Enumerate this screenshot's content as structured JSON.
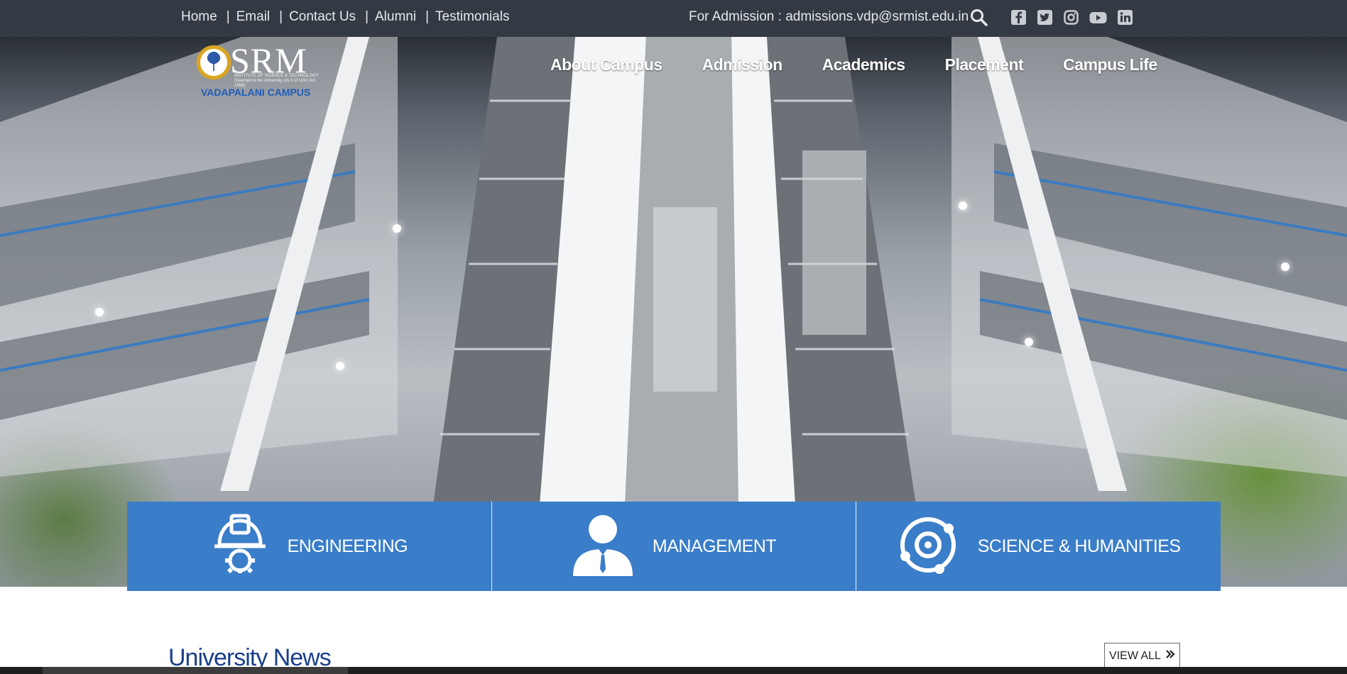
{
  "topbar": {
    "links": [
      "Home",
      "Email",
      "Contact Us",
      "Alumni",
      "Testimonials"
    ],
    "separator": "|",
    "admission_text": "For Admission : admissions.vdp@srmist.edu.in",
    "icons": [
      "search-icon",
      "facebook-icon",
      "twitter-icon",
      "instagram-icon",
      "youtube-icon",
      "linkedin-icon"
    ]
  },
  "logo": {
    "name": "SRM",
    "subtitle": "INSTITUTE OF SCIENCE & TECHNOLOGY (Deemed to be University u/s 3 of UGC Act, 1956)",
    "campus": "VADAPALANI CAMPUS"
  },
  "nav": {
    "items": [
      "About Campus",
      "Admission",
      "Academics",
      "Placement",
      "Campus Life"
    ]
  },
  "categories": [
    {
      "label": "ENGINEERING",
      "icon": "engineering-helmet-gear-icon"
    },
    {
      "label": "MANAGEMENT",
      "icon": "businessman-icon"
    },
    {
      "label": "SCIENCE & HUMANITIES",
      "icon": "atom-orbit-icon"
    }
  ],
  "news": {
    "title": "University News",
    "view_all": "VIEW ALL",
    "view_all_icon": "double-chevron-right-icon"
  },
  "colors": {
    "topbar_bg": "#343a44",
    "category_blue": "#3a7dc9",
    "news_title": "#1a3f8a",
    "logo_campus": "#1f5db8"
  }
}
